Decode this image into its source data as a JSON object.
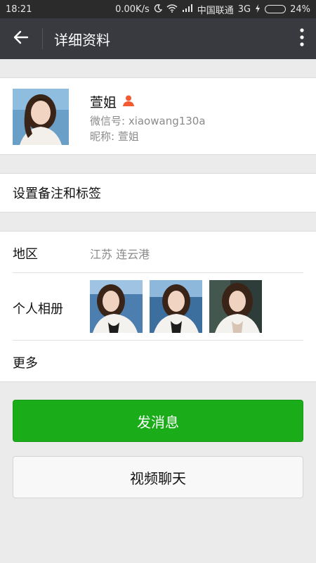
{
  "status_bar": {
    "time": "18:21",
    "network_speed": "0.00K/s",
    "carrier": "中国联通",
    "network_type": "3G",
    "battery": "24%",
    "battery_level": 0.24,
    "icons": [
      "moon-icon",
      "wifi-icon",
      "signal-icon",
      "charging-icon",
      "battery-icon"
    ]
  },
  "nav": {
    "title": "详细资料",
    "icons": [
      "back-arrow-icon",
      "more-vertical-icon"
    ]
  },
  "profile": {
    "name": "萱姐",
    "wechat_id": "微信号: xiaowang130a",
    "nickname": "昵称: 萱姐",
    "badge_icon": "contact-person-icon",
    "badge_color": "#f25a32"
  },
  "remark": {
    "label": "设置备注和标签"
  },
  "details": {
    "region_label": "地区",
    "region_value": "江苏  连云港",
    "album_label": "个人相册",
    "more_label": "更多"
  },
  "buttons": {
    "send_message": "发消息",
    "video_chat": "视频聊天"
  },
  "colors": {
    "nav_bg": "#393a3f",
    "status_bg": "#2b2b2b",
    "primary_green": "#1aad19",
    "page_bg": "#ebebeb"
  }
}
